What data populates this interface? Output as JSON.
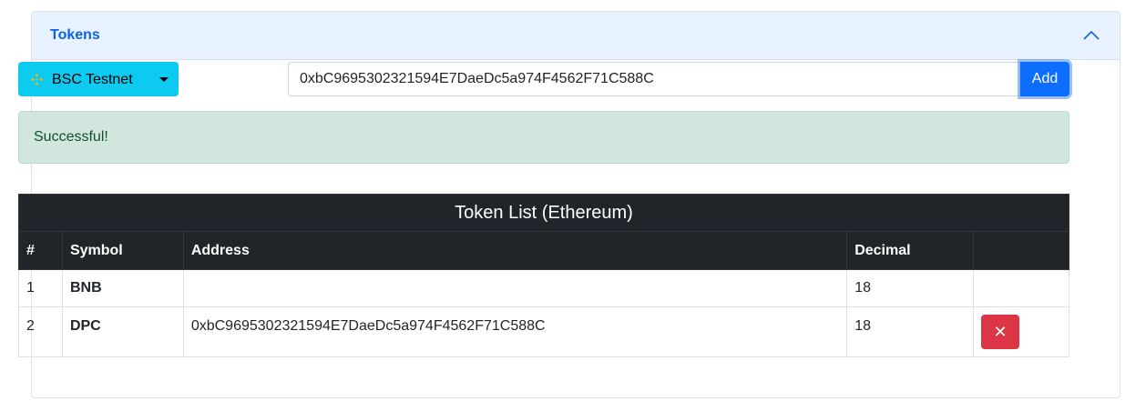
{
  "card": {
    "title": "Tokens"
  },
  "network": {
    "label": "BSC Testnet"
  },
  "address_input": {
    "value": "0xbC9695302321594E7DaeDc5a974F4562F71C588C"
  },
  "add_button": {
    "label": "Add"
  },
  "alert": {
    "message": "Successful!"
  },
  "token_table": {
    "caption": "Token List (Ethereum)",
    "headers": [
      "#",
      "Symbol",
      "Address",
      "Decimal",
      ""
    ],
    "rows": [
      {
        "index": "1",
        "symbol": "BNB",
        "address": "",
        "decimal": "18"
      },
      {
        "index": "2",
        "symbol": "DPC",
        "address": "0xbC9695302321594E7DaeDc5a974F4562F71C588C",
        "decimal": "18",
        "delete_icon": "✕"
      }
    ]
  },
  "colors": {
    "header_bg": "#e7f1ff",
    "title": "#0c63e4",
    "network_btn": "#0dcaf0",
    "add_btn": "#0d6efd",
    "alert_bg": "#d1e7dd",
    "table_head": "#212529",
    "delete_btn": "#dc3545"
  }
}
